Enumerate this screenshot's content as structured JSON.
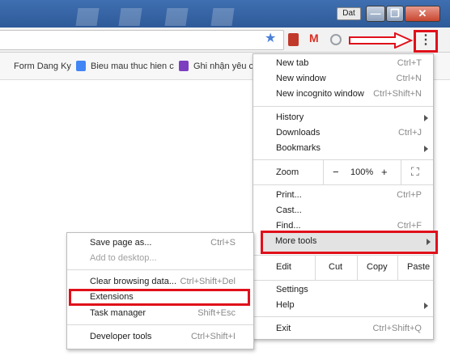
{
  "window": {
    "user_name": "Dat",
    "controls": {
      "minimize": "—",
      "maximize": "❐",
      "close": "✕"
    }
  },
  "toolbar": {
    "bookmark_star": "★",
    "gmail_icon": "M",
    "menu_glyph": "⋮"
  },
  "bookmarks": [
    {
      "label": "Form Dang Ky"
    },
    {
      "label": "Bieu mau thuc hien c",
      "icon_color": "#4285f4"
    },
    {
      "label": "Ghi nhận yêu c",
      "icon_color": "#7b3fbf"
    }
  ],
  "menu": {
    "new_tab": {
      "label": "New tab",
      "shortcut": "Ctrl+T"
    },
    "new_window": {
      "label": "New window",
      "shortcut": "Ctrl+N"
    },
    "new_incognito": {
      "label": "New incognito window",
      "shortcut": "Ctrl+Shift+N"
    },
    "history": {
      "label": "History"
    },
    "downloads": {
      "label": "Downloads",
      "shortcut": "Ctrl+J"
    },
    "bookmarks": {
      "label": "Bookmarks"
    },
    "zoom": {
      "label": "Zoom",
      "minus": "−",
      "value": "100%",
      "plus": "+",
      "fullscreen": "⛶"
    },
    "print": {
      "label": "Print...",
      "shortcut": "Ctrl+P"
    },
    "cast": {
      "label": "Cast..."
    },
    "find": {
      "label": "Find...",
      "shortcut": "Ctrl+F"
    },
    "more_tools": {
      "label": "More tools"
    },
    "edit": {
      "label": "Edit",
      "cut": "Cut",
      "copy": "Copy",
      "paste": "Paste"
    },
    "settings": {
      "label": "Settings"
    },
    "help": {
      "label": "Help"
    },
    "exit": {
      "label": "Exit",
      "shortcut": "Ctrl+Shift+Q"
    }
  },
  "submenu": {
    "save_page": {
      "label": "Save page as...",
      "shortcut": "Ctrl+S"
    },
    "add_desktop": {
      "label": "Add to desktop..."
    },
    "clear_data": {
      "label": "Clear browsing data...",
      "shortcut": "Ctrl+Shift+Del"
    },
    "extensions": {
      "label": "Extensions"
    },
    "task_manager": {
      "label": "Task manager",
      "shortcut": "Shift+Esc"
    },
    "dev_tools": {
      "label": "Developer tools",
      "shortcut": "Ctrl+Shift+I"
    }
  },
  "colors": {
    "highlight_border": "#e0101a",
    "titlebar": "#2e5a99"
  }
}
